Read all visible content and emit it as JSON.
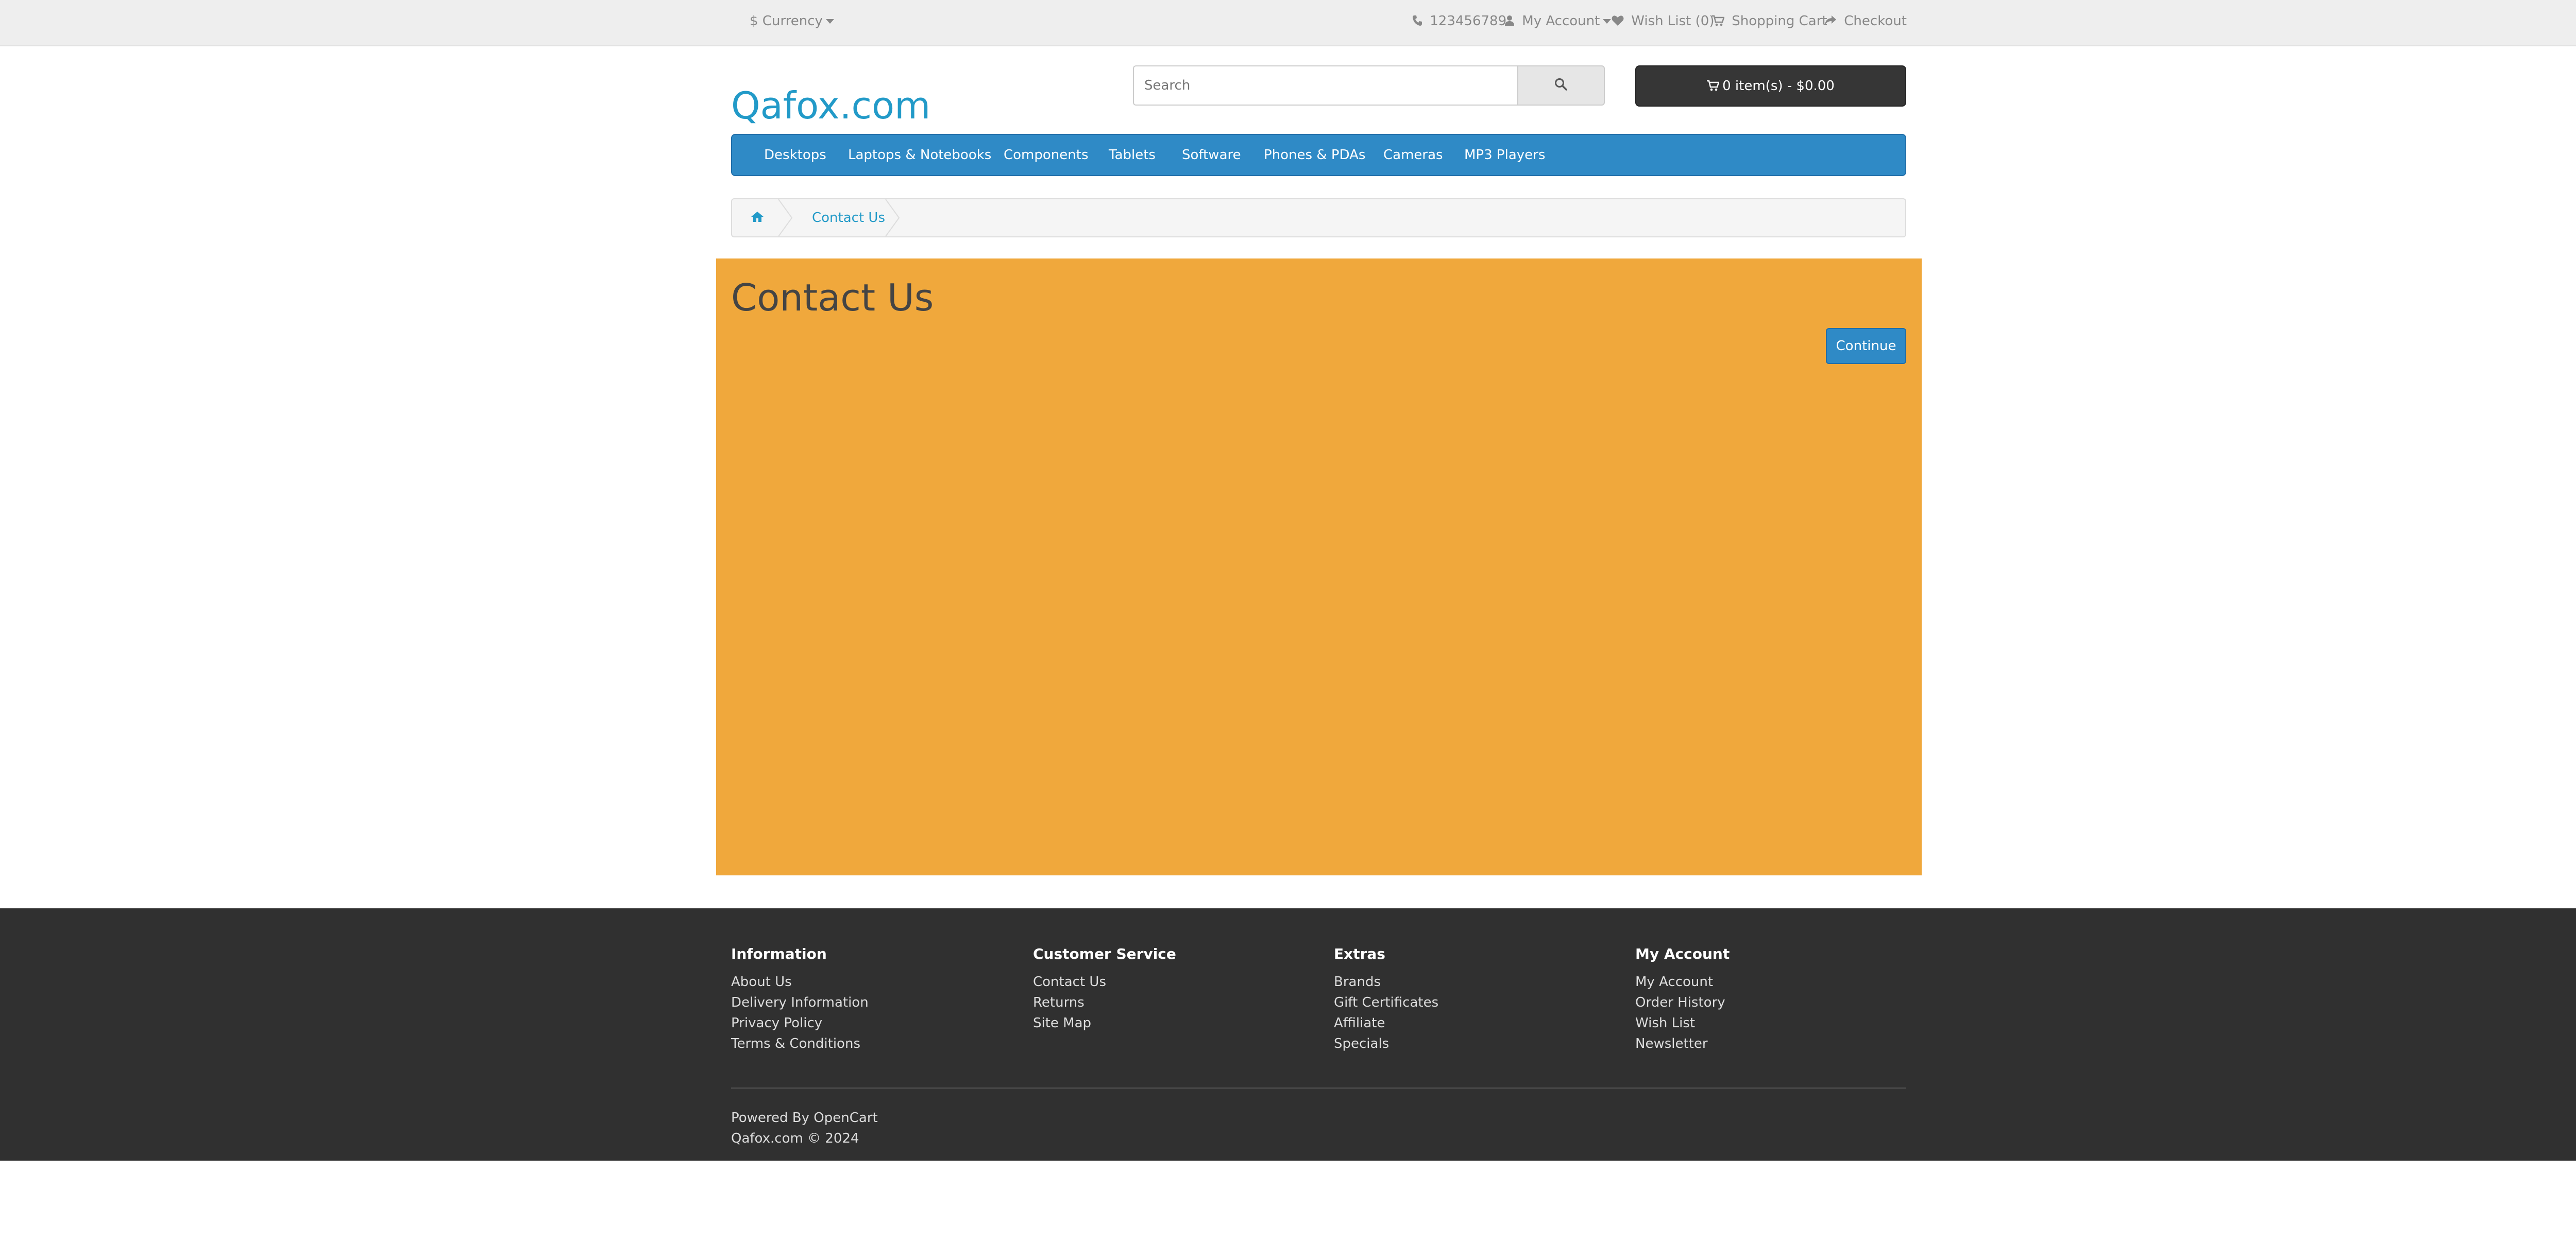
{
  "topbar": {
    "currency_label": "$ Currency",
    "phone": "123456789",
    "my_account": "My Account",
    "wish_list": "Wish List (0)",
    "shopping_cart": "Shopping Cart",
    "checkout": "Checkout"
  },
  "header": {
    "logo": "Qafox.com",
    "search_placeholder": "Search",
    "cart_label": "0 item(s) - $0.00"
  },
  "menu": {
    "items": [
      "Desktops",
      "Laptops & Notebooks",
      "Components",
      "Tablets",
      "Software",
      "Phones & PDAs",
      "Cameras",
      "MP3 Players"
    ]
  },
  "breadcrumb": {
    "current": "Contact Us"
  },
  "main": {
    "title": "Contact Us",
    "continue_label": "Continue",
    "content_bg": "#f0a83c"
  },
  "footer": {
    "information": {
      "heading": "Information",
      "links": [
        "About Us",
        "Delivery Information",
        "Privacy Policy",
        "Terms & Conditions"
      ]
    },
    "customer_service": {
      "heading": "Customer Service",
      "links": [
        "Contact Us",
        "Returns",
        "Site Map"
      ]
    },
    "extras": {
      "heading": "Extras",
      "links": [
        "Brands",
        "Gift Certificates",
        "Affiliate",
        "Specials"
      ]
    },
    "my_account": {
      "heading": "My Account",
      "links": [
        "My Account",
        "Order History",
        "Wish List",
        "Newsletter"
      ]
    },
    "powered_by": "Powered By",
    "opencart": "OpenCart",
    "copyright": "Qafox.com © 2024"
  },
  "colors": {
    "accent": "#229ac8",
    "menu_bg": "#2f8ac6",
    "cart_bg": "#363636",
    "footer_bg": "#303030"
  }
}
